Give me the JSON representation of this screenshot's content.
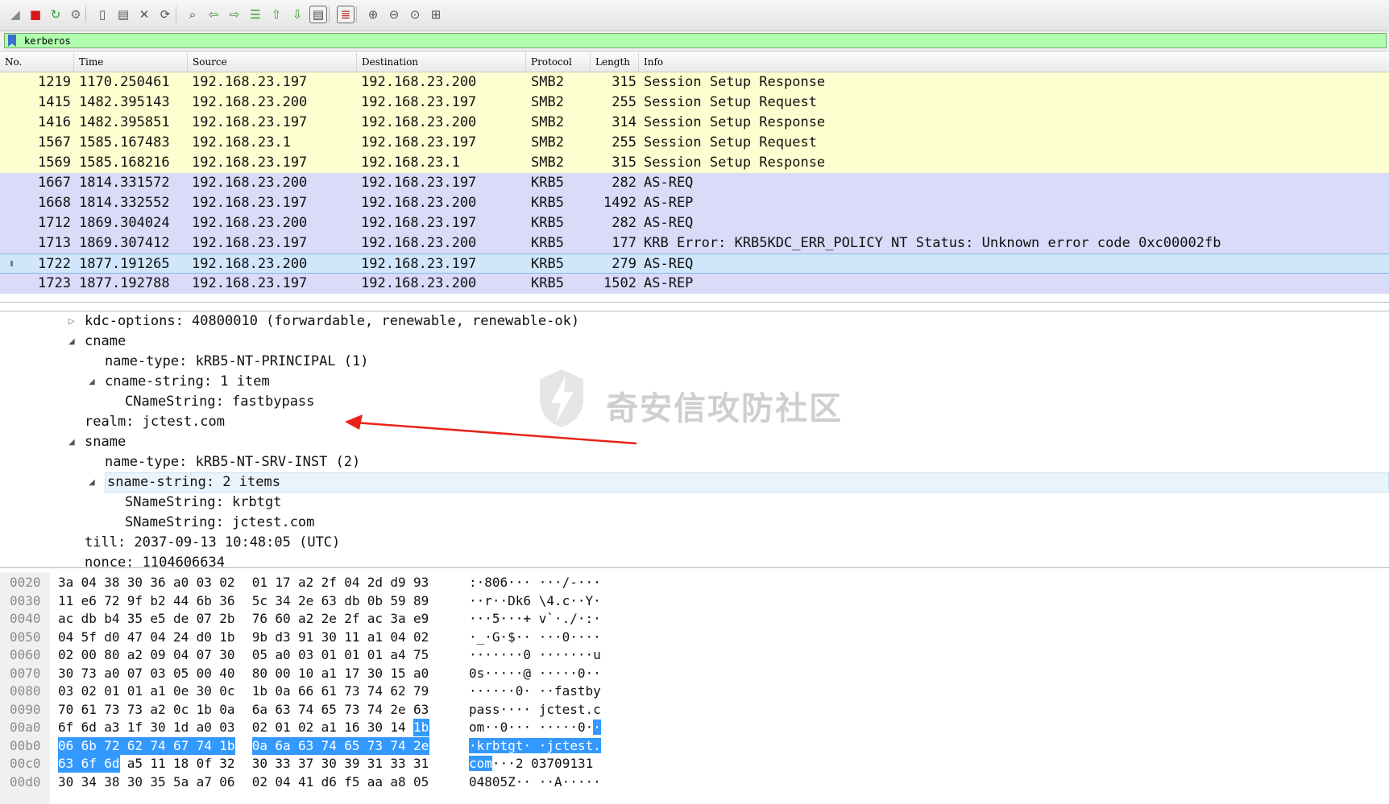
{
  "toolbar": {
    "icons": [
      "shark-fin-icon",
      "stop-icon",
      "restart-icon",
      "capture-options-icon",
      "open-file-icon",
      "save-file-icon",
      "close-file-icon",
      "reload-file-icon",
      "find-icon",
      "go-back-icon",
      "go-forward-icon",
      "go-to-packet-icon",
      "go-first-icon",
      "go-last-icon",
      "autoscroll-icon",
      "colorize-icon",
      "zoom-in-icon",
      "zoom-out-icon",
      "zoom-normal-icon",
      "resize-columns-icon"
    ]
  },
  "filter": {
    "value": "kerberos"
  },
  "columns": [
    "No.",
    "Time",
    "Source",
    "Destination",
    "Protocol",
    "Length",
    "Info"
  ],
  "packets": [
    {
      "no": "1219",
      "time": "1170.250461",
      "src": "192.168.23.197",
      "dst": "192.168.23.200",
      "proto": "SMB2",
      "len": "315",
      "info": "Session Setup Response",
      "type": "smb"
    },
    {
      "no": "1415",
      "time": "1482.395143",
      "src": "192.168.23.200",
      "dst": "192.168.23.197",
      "proto": "SMB2",
      "len": "255",
      "info": "Session Setup Request",
      "type": "smb"
    },
    {
      "no": "1416",
      "time": "1482.395851",
      "src": "192.168.23.197",
      "dst": "192.168.23.200",
      "proto": "SMB2",
      "len": "314",
      "info": "Session Setup Response",
      "type": "smb"
    },
    {
      "no": "1567",
      "time": "1585.167483",
      "src": "192.168.23.1",
      "dst": "192.168.23.197",
      "proto": "SMB2",
      "len": "255",
      "info": "Session Setup Request",
      "type": "smb"
    },
    {
      "no": "1569",
      "time": "1585.168216",
      "src": "192.168.23.197",
      "dst": "192.168.23.1",
      "proto": "SMB2",
      "len": "315",
      "info": "Session Setup Response",
      "type": "smb"
    },
    {
      "no": "1667",
      "time": "1814.331572",
      "src": "192.168.23.200",
      "dst": "192.168.23.197",
      "proto": "KRB5",
      "len": "282",
      "info": "AS-REQ",
      "type": "krb"
    },
    {
      "no": "1668",
      "time": "1814.332552",
      "src": "192.168.23.197",
      "dst": "192.168.23.200",
      "proto": "KRB5",
      "len": "1492",
      "info": "AS-REP",
      "type": "krb"
    },
    {
      "no": "1712",
      "time": "1869.304024",
      "src": "192.168.23.200",
      "dst": "192.168.23.197",
      "proto": "KRB5",
      "len": "282",
      "info": "AS-REQ",
      "type": "krb"
    },
    {
      "no": "1713",
      "time": "1869.307412",
      "src": "192.168.23.197",
      "dst": "192.168.23.200",
      "proto": "KRB5",
      "len": "177",
      "info": "KRB Error: KRB5KDC_ERR_POLICY NT Status: Unknown error code 0xc00002fb",
      "type": "krb"
    },
    {
      "no": "1722",
      "time": "1877.191265",
      "src": "192.168.23.200",
      "dst": "192.168.23.197",
      "proto": "KRB5",
      "len": "279",
      "info": "AS-REQ",
      "type": "sel"
    },
    {
      "no": "1723",
      "time": "1877.192788",
      "src": "192.168.23.197",
      "dst": "192.168.23.200",
      "proto": "KRB5",
      "len": "1502",
      "info": "AS-REP",
      "type": "krb"
    }
  ],
  "details": [
    {
      "indent": 0,
      "toggle": "collapsed",
      "text": "kdc-options: 40800010 (forwardable, renewable, renewable-ok)"
    },
    {
      "indent": 0,
      "toggle": "expanded",
      "text": "cname"
    },
    {
      "indent": 1,
      "toggle": "none",
      "text": "name-type: kRB5-NT-PRINCIPAL (1)"
    },
    {
      "indent": 1,
      "toggle": "expanded",
      "text": "cname-string: 1 item"
    },
    {
      "indent": 2,
      "toggle": "none",
      "text": "CNameString: fastbypass"
    },
    {
      "indent": 0,
      "toggle": "none",
      "text": "realm: jctest.com"
    },
    {
      "indent": 0,
      "toggle": "expanded",
      "text": "sname"
    },
    {
      "indent": 1,
      "toggle": "none",
      "text": "name-type: kRB5-NT-SRV-INST (2)"
    },
    {
      "indent": 1,
      "toggle": "expanded",
      "text": "sname-string: 2 items",
      "highlight": true
    },
    {
      "indent": 2,
      "toggle": "none",
      "text": "SNameString: krbtgt"
    },
    {
      "indent": 2,
      "toggle": "none",
      "text": "SNameString: jctest.com"
    },
    {
      "indent": 0,
      "toggle": "none",
      "text": "till: 2037-09-13 10:48:05 (UTC)"
    },
    {
      "indent": 0,
      "toggle": "none",
      "text": "nonce: 1104606634"
    }
  ],
  "watermark": {
    "text": "奇安信攻防社区"
  },
  "hex": [
    {
      "off": "0020",
      "bytes": [
        "3a",
        "04",
        "38",
        "30",
        "36",
        "a0",
        "03",
        "02",
        "01",
        "17",
        "a2",
        "2f",
        "04",
        "2d",
        "d9",
        "93"
      ],
      "ascii": ":·806··· ···/-···",
      "sel": []
    },
    {
      "off": "0030",
      "bytes": [
        "11",
        "e6",
        "72",
        "9f",
        "b2",
        "44",
        "6b",
        "36",
        "5c",
        "34",
        "2e",
        "63",
        "db",
        "0b",
        "59",
        "89"
      ],
      "ascii": "··r··Dk6 \\4.c··Y·",
      "sel": []
    },
    {
      "off": "0040",
      "bytes": [
        "ac",
        "db",
        "b4",
        "35",
        "e5",
        "de",
        "07",
        "2b",
        "76",
        "60",
        "a2",
        "2e",
        "2f",
        "ac",
        "3a",
        "e9"
      ],
      "ascii": "···5···+ v`·./·:·",
      "sel": []
    },
    {
      "off": "0050",
      "bytes": [
        "04",
        "5f",
        "d0",
        "47",
        "04",
        "24",
        "d0",
        "1b",
        "9b",
        "d3",
        "91",
        "30",
        "11",
        "a1",
        "04",
        "02"
      ],
      "ascii": "·_·G·$·· ···0····",
      "sel": []
    },
    {
      "off": "0060",
      "bytes": [
        "02",
        "00",
        "80",
        "a2",
        "09",
        "04",
        "07",
        "30",
        "05",
        "a0",
        "03",
        "01",
        "01",
        "01",
        "a4",
        "75"
      ],
      "ascii": "·······0 ·······u",
      "sel": []
    },
    {
      "off": "0070",
      "bytes": [
        "30",
        "73",
        "a0",
        "07",
        "03",
        "05",
        "00",
        "40",
        "80",
        "00",
        "10",
        "a1",
        "17",
        "30",
        "15",
        "a0"
      ],
      "ascii": "0s·····@ ·····0··",
      "sel": []
    },
    {
      "off": "0080",
      "bytes": [
        "03",
        "02",
        "01",
        "01",
        "a1",
        "0e",
        "30",
        "0c",
        "1b",
        "0a",
        "66",
        "61",
        "73",
        "74",
        "62",
        "79"
      ],
      "ascii": "······0· ··fastby",
      "sel": []
    },
    {
      "off": "0090",
      "bytes": [
        "70",
        "61",
        "73",
        "73",
        "a2",
        "0c",
        "1b",
        "0a",
        "6a",
        "63",
        "74",
        "65",
        "73",
        "74",
        "2e",
        "63"
      ],
      "ascii": "pass···· jctest.c",
      "sel": []
    },
    {
      "off": "00a0",
      "bytes": [
        "6f",
        "6d",
        "a3",
        "1f",
        "30",
        "1d",
        "a0",
        "03",
        "02",
        "01",
        "02",
        "a1",
        "16",
        "30",
        "14",
        "1b"
      ],
      "ascii": "om··0··· ·····0··",
      "sel": [
        15
      ]
    },
    {
      "off": "00b0",
      "bytes": [
        "06",
        "6b",
        "72",
        "62",
        "74",
        "67",
        "74",
        "1b",
        "0a",
        "6a",
        "63",
        "74",
        "65",
        "73",
        "74",
        "2e"
      ],
      "ascii": "·krbtgt· ·jctest.",
      "sel": [
        0,
        1,
        2,
        3,
        4,
        5,
        6,
        7,
        8,
        9,
        10,
        11,
        12,
        13,
        14,
        15
      ]
    },
    {
      "off": "00c0",
      "bytes": [
        "63",
        "6f",
        "6d",
        "a5",
        "11",
        "18",
        "0f",
        "32",
        "30",
        "33",
        "37",
        "30",
        "39",
        "31",
        "33",
        "31"
      ],
      "ascii": "com···2 03709131",
      "sel": [
        0,
        1,
        2
      ]
    },
    {
      "off": "00d0",
      "bytes": [
        "30",
        "34",
        "38",
        "30",
        "35",
        "5a",
        "a7",
        "06",
        "02",
        "04",
        "41",
        "d6",
        "f5",
        "aa",
        "a8",
        "05"
      ],
      "ascii": "04805Z·· ··A·····",
      "sel": []
    }
  ]
}
